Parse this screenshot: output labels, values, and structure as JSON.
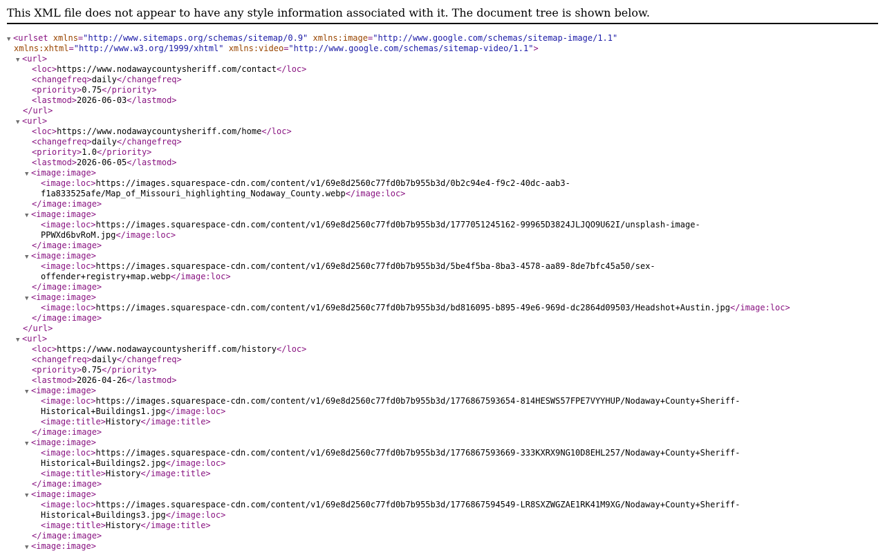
{
  "header": {
    "notice": "This XML file does not appear to have any style information associated with it. The document tree is shown below."
  },
  "colors": {
    "tag": "#881280",
    "attr_name": "#994500",
    "attr_value": "#1a1aa6",
    "text": "#000000",
    "toggle": "#6e6e6e"
  },
  "icons": {
    "expanded": "collapse-triangle-icon"
  },
  "toggle_glyph": "▼",
  "lines": [
    {
      "i": 0,
      "t": true,
      "p": [
        [
          "tg",
          "<urlset "
        ],
        [
          "an",
          "xmlns"
        ],
        [
          "tg",
          "="
        ],
        [
          "av",
          "\"http://www.sitemaps.org/schemas/sitemap/0.9\""
        ],
        [
          "tg",
          " "
        ],
        [
          "an",
          "xmlns:image"
        ],
        [
          "tg",
          "="
        ],
        [
          "av",
          "\"http://www.google.com/schemas/sitemap-image/1.1\""
        ]
      ]
    },
    {
      "i": 0,
      "p": [
        [
          "an",
          "xmlns:xhtml"
        ],
        [
          "tg",
          "="
        ],
        [
          "av",
          "\"http://www.w3.org/1999/xhtml\""
        ],
        [
          "tg",
          " "
        ],
        [
          "an",
          "xmlns:video"
        ],
        [
          "tg",
          "="
        ],
        [
          "av",
          "\"http://www.google.com/schemas/sitemap-video/1.1\""
        ],
        [
          "tg",
          ">"
        ]
      ]
    },
    {
      "i": 1,
      "t": true,
      "p": [
        [
          "tg",
          "<url>"
        ]
      ]
    },
    {
      "i": 2,
      "p": [
        [
          "tg",
          "<loc>"
        ],
        [
          "tx",
          "https://www.nodawaycountysheriff.com/contact"
        ],
        [
          "tg",
          "</loc>"
        ]
      ]
    },
    {
      "i": 2,
      "p": [
        [
          "tg",
          "<changefreq>"
        ],
        [
          "tx",
          "daily"
        ],
        [
          "tg",
          "</changefreq>"
        ]
      ]
    },
    {
      "i": 2,
      "p": [
        [
          "tg",
          "<priority>"
        ],
        [
          "tx",
          "0.75"
        ],
        [
          "tg",
          "</priority>"
        ]
      ]
    },
    {
      "i": 2,
      "p": [
        [
          "tg",
          "<lastmod>"
        ],
        [
          "tx",
          "2026-06-03"
        ],
        [
          "tg",
          "</lastmod>"
        ]
      ]
    },
    {
      "i": 1,
      "p": [
        [
          "tg",
          "</url>"
        ]
      ]
    },
    {
      "i": 1,
      "t": true,
      "p": [
        [
          "tg",
          "<url>"
        ]
      ]
    },
    {
      "i": 2,
      "p": [
        [
          "tg",
          "<loc>"
        ],
        [
          "tx",
          "https://www.nodawaycountysheriff.com/home"
        ],
        [
          "tg",
          "</loc>"
        ]
      ]
    },
    {
      "i": 2,
      "p": [
        [
          "tg",
          "<changefreq>"
        ],
        [
          "tx",
          "daily"
        ],
        [
          "tg",
          "</changefreq>"
        ]
      ]
    },
    {
      "i": 2,
      "p": [
        [
          "tg",
          "<priority>"
        ],
        [
          "tx",
          "1.0"
        ],
        [
          "tg",
          "</priority>"
        ]
      ]
    },
    {
      "i": 2,
      "p": [
        [
          "tg",
          "<lastmod>"
        ],
        [
          "tx",
          "2026-06-05"
        ],
        [
          "tg",
          "</lastmod>"
        ]
      ]
    },
    {
      "i": 2,
      "t": true,
      "p": [
        [
          "tg",
          "<image:image>"
        ]
      ]
    },
    {
      "i": 3,
      "p": [
        [
          "tg",
          "<image:loc>"
        ],
        [
          "tx",
          "https://images.squarespace-cdn.com/content/v1/69e8d2560c77fd0b7b955b3d/0b2c94e4-f9c2-40dc-aab3-"
        ]
      ]
    },
    {
      "i": 3,
      "p": [
        [
          "tx",
          "f1a833525afe/Map_of_Missouri_highlighting_Nodaway_County.webp"
        ],
        [
          "tg",
          "</image:loc>"
        ]
      ]
    },
    {
      "i": 2,
      "p": [
        [
          "tg",
          "</image:image>"
        ]
      ]
    },
    {
      "i": 2,
      "t": true,
      "p": [
        [
          "tg",
          "<image:image>"
        ]
      ]
    },
    {
      "i": 3,
      "p": [
        [
          "tg",
          "<image:loc>"
        ],
        [
          "tx",
          "https://images.squarespace-cdn.com/content/v1/69e8d2560c77fd0b7b955b3d/1777051245162-99965D3824JLJQO9U62I/unsplash-image-"
        ]
      ]
    },
    {
      "i": 3,
      "p": [
        [
          "tx",
          "PPWXd6bvRoM.jpg"
        ],
        [
          "tg",
          "</image:loc>"
        ]
      ]
    },
    {
      "i": 2,
      "p": [
        [
          "tg",
          "</image:image>"
        ]
      ]
    },
    {
      "i": 2,
      "t": true,
      "p": [
        [
          "tg",
          "<image:image>"
        ]
      ]
    },
    {
      "i": 3,
      "p": [
        [
          "tg",
          "<image:loc>"
        ],
        [
          "tx",
          "https://images.squarespace-cdn.com/content/v1/69e8d2560c77fd0b7b955b3d/5be4f5ba-8ba3-4578-aa89-8de7bfc45a50/sex-"
        ]
      ]
    },
    {
      "i": 3,
      "p": [
        [
          "tx",
          "offender+registry+map.webp"
        ],
        [
          "tg",
          "</image:loc>"
        ]
      ]
    },
    {
      "i": 2,
      "p": [
        [
          "tg",
          "</image:image>"
        ]
      ]
    },
    {
      "i": 2,
      "t": true,
      "p": [
        [
          "tg",
          "<image:image>"
        ]
      ]
    },
    {
      "i": 3,
      "p": [
        [
          "tg",
          "<image:loc>"
        ],
        [
          "tx",
          "https://images.squarespace-cdn.com/content/v1/69e8d2560c77fd0b7b955b3d/bd816095-b895-49e6-969d-dc2864d09503/Headshot+Austin.jpg"
        ],
        [
          "tg",
          "</image:loc>"
        ]
      ]
    },
    {
      "i": 2,
      "p": [
        [
          "tg",
          "</image:image>"
        ]
      ]
    },
    {
      "i": 1,
      "p": [
        [
          "tg",
          "</url>"
        ]
      ]
    },
    {
      "i": 1,
      "t": true,
      "p": [
        [
          "tg",
          "<url>"
        ]
      ]
    },
    {
      "i": 2,
      "p": [
        [
          "tg",
          "<loc>"
        ],
        [
          "tx",
          "https://www.nodawaycountysheriff.com/history"
        ],
        [
          "tg",
          "</loc>"
        ]
      ]
    },
    {
      "i": 2,
      "p": [
        [
          "tg",
          "<changefreq>"
        ],
        [
          "tx",
          "daily"
        ],
        [
          "tg",
          "</changefreq>"
        ]
      ]
    },
    {
      "i": 2,
      "p": [
        [
          "tg",
          "<priority>"
        ],
        [
          "tx",
          "0.75"
        ],
        [
          "tg",
          "</priority>"
        ]
      ]
    },
    {
      "i": 2,
      "p": [
        [
          "tg",
          "<lastmod>"
        ],
        [
          "tx",
          "2026-04-26"
        ],
        [
          "tg",
          "</lastmod>"
        ]
      ]
    },
    {
      "i": 2,
      "t": true,
      "p": [
        [
          "tg",
          "<image:image>"
        ]
      ]
    },
    {
      "i": 3,
      "p": [
        [
          "tg",
          "<image:loc>"
        ],
        [
          "tx",
          "https://images.squarespace-cdn.com/content/v1/69e8d2560c77fd0b7b955b3d/1776867593654-814HESWS57FPE7VYYHUP/Nodaway+County+Sheriff-"
        ]
      ]
    },
    {
      "i": 3,
      "p": [
        [
          "tx",
          "Historical+Buildings1.jpg"
        ],
        [
          "tg",
          "</image:loc>"
        ]
      ]
    },
    {
      "i": 3,
      "p": [
        [
          "tg",
          "<image:title>"
        ],
        [
          "tx",
          "History"
        ],
        [
          "tg",
          "</image:title>"
        ]
      ]
    },
    {
      "i": 2,
      "p": [
        [
          "tg",
          "</image:image>"
        ]
      ]
    },
    {
      "i": 2,
      "t": true,
      "p": [
        [
          "tg",
          "<image:image>"
        ]
      ]
    },
    {
      "i": 3,
      "p": [
        [
          "tg",
          "<image:loc>"
        ],
        [
          "tx",
          "https://images.squarespace-cdn.com/content/v1/69e8d2560c77fd0b7b955b3d/1776867593669-333KXRX9NG10D8EHL257/Nodaway+County+Sheriff-"
        ]
      ]
    },
    {
      "i": 3,
      "p": [
        [
          "tx",
          "Historical+Buildings2.jpg"
        ],
        [
          "tg",
          "</image:loc>"
        ]
      ]
    },
    {
      "i": 3,
      "p": [
        [
          "tg",
          "<image:title>"
        ],
        [
          "tx",
          "History"
        ],
        [
          "tg",
          "</image:title>"
        ]
      ]
    },
    {
      "i": 2,
      "p": [
        [
          "tg",
          "</image:image>"
        ]
      ]
    },
    {
      "i": 2,
      "t": true,
      "p": [
        [
          "tg",
          "<image:image>"
        ]
      ]
    },
    {
      "i": 3,
      "p": [
        [
          "tg",
          "<image:loc>"
        ],
        [
          "tx",
          "https://images.squarespace-cdn.com/content/v1/69e8d2560c77fd0b7b955b3d/1776867594549-LR8SXZWGZAE1RK41M9XG/Nodaway+County+Sheriff-"
        ]
      ]
    },
    {
      "i": 3,
      "p": [
        [
          "tx",
          "Historical+Buildings3.jpg"
        ],
        [
          "tg",
          "</image:loc>"
        ]
      ]
    },
    {
      "i": 3,
      "p": [
        [
          "tg",
          "<image:title>"
        ],
        [
          "tx",
          "History"
        ],
        [
          "tg",
          "</image:title>"
        ]
      ]
    },
    {
      "i": 2,
      "p": [
        [
          "tg",
          "</image:image>"
        ]
      ]
    },
    {
      "i": 2,
      "t": true,
      "p": [
        [
          "tg",
          "<image:image>"
        ]
      ]
    }
  ]
}
